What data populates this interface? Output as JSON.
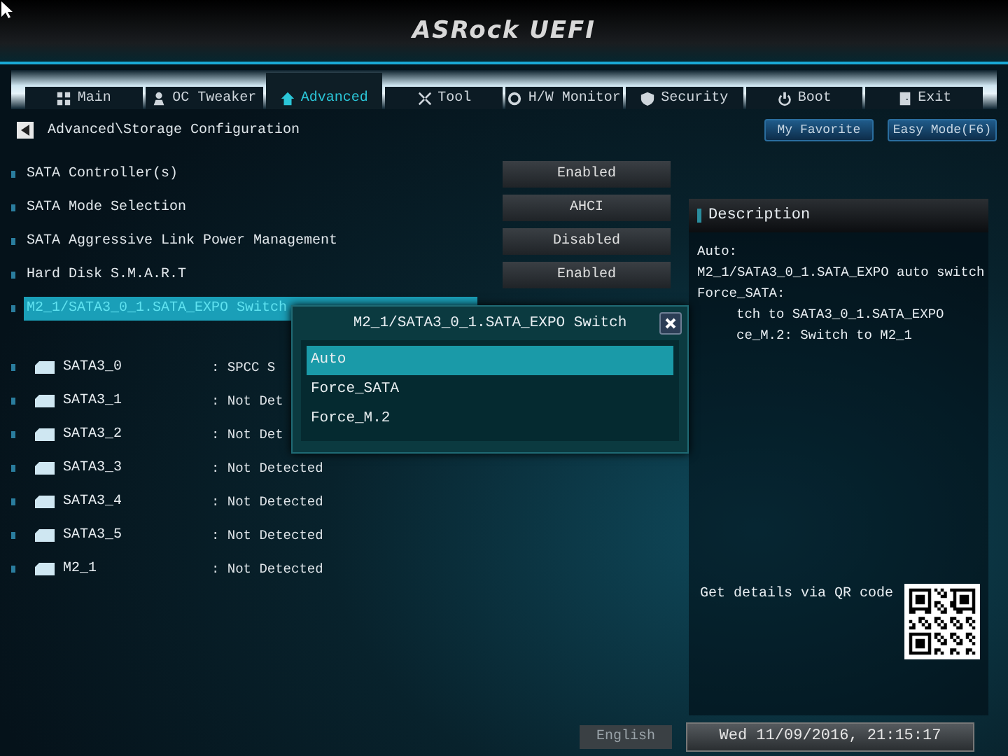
{
  "header": {
    "logo": "ASRock UEFI"
  },
  "tabs": [
    {
      "label": "Main",
      "selected": false
    },
    {
      "label": "OC Tweaker",
      "selected": false
    },
    {
      "label": "Advanced",
      "selected": true
    },
    {
      "label": "Tool",
      "selected": false
    },
    {
      "label": "H/W Monitor",
      "selected": false
    },
    {
      "label": "Security",
      "selected": false
    },
    {
      "label": "Boot",
      "selected": false
    },
    {
      "label": "Exit",
      "selected": false
    }
  ],
  "breadcrumb": "Advanced\\Storage Configuration",
  "top_buttons": [
    "My Favorite",
    "Easy Mode(F6)"
  ],
  "settings": [
    {
      "label": "SATA Controller(s)",
      "value": "Enabled",
      "selected": false
    },
    {
      "label": "SATA Mode Selection",
      "value": "AHCI",
      "selected": false
    },
    {
      "label": "SATA Aggressive Link Power Management",
      "value": "Disabled",
      "selected": false
    },
    {
      "label": "Hard Disk S.M.A.R.T",
      "value": "Enabled",
      "selected": false
    },
    {
      "label": "M2_1/SATA3_0_1.SATA_EXPO Switch",
      "selected": true
    }
  ],
  "devices": [
    {
      "name": "SATA3_0",
      "value": ": SPCC S"
    },
    {
      "name": "SATA3_1",
      "value": ": Not Det"
    },
    {
      "name": "SATA3_2",
      "value": ": Not Det"
    },
    {
      "name": "SATA3_3",
      "value": ": Not Detected"
    },
    {
      "name": "SATA3_4",
      "value": ": Not Detected"
    },
    {
      "name": "SATA3_5",
      "value": ": Not Detected"
    },
    {
      "name": "M2_1",
      "value": ": Not Detected"
    }
  ],
  "description": {
    "title": "Description",
    "lines": [
      "Auto:",
      "M2_1/SATA3_0_1.SATA_EXPO auto switch",
      "Force_SATA:",
      "tch to SATA3_0_1.SATA_EXPO",
      "ce_M.2: Switch to M2_1"
    ],
    "qr_caption": "Get details via QR code"
  },
  "dialog": {
    "title": "M2_1/SATA3_0_1.SATA_EXPO Switch",
    "options": [
      {
        "label": "Auto",
        "selected": true
      },
      {
        "label": "Force_SATA",
        "selected": false
      },
      {
        "label": "Force_M.2",
        "selected": false
      }
    ]
  },
  "status_bar": {
    "language": "English",
    "datetime": "Wed 11/09/2016, 21:15:17"
  }
}
